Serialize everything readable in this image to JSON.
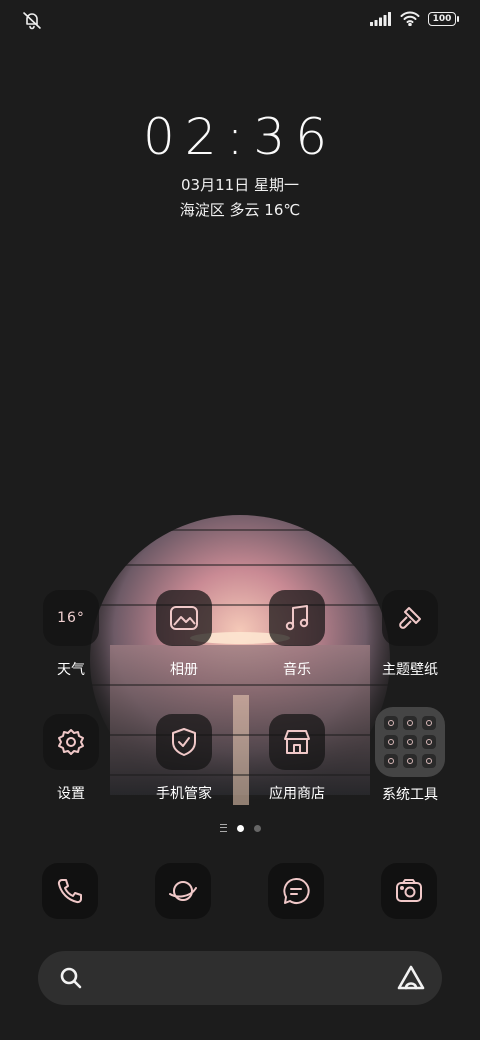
{
  "status_bar": {
    "mute_icon": "bell-off-icon",
    "signal_icon": "cellular-signal-icon",
    "wifi_icon": "wifi-icon",
    "battery_level": "100"
  },
  "clock": {
    "time": "02:36",
    "date": "03月11日 星期一",
    "weather": "海淀区 多云 16℃"
  },
  "apps_row1": [
    {
      "label": "天气",
      "tile_text": "16°",
      "icon": "weather-icon"
    },
    {
      "label": "相册",
      "icon": "gallery-icon"
    },
    {
      "label": "音乐",
      "icon": "music-note-icon"
    },
    {
      "label": "主题壁纸",
      "icon": "paintbrush-icon"
    }
  ],
  "apps_row2": [
    {
      "label": "设置",
      "icon": "gear-icon"
    },
    {
      "label": "手机管家",
      "icon": "shield-check-icon"
    },
    {
      "label": "应用商店",
      "icon": "store-icon"
    },
    {
      "label": "系统工具",
      "icon": "folder-icon"
    }
  ],
  "pager": {
    "pages": 2,
    "current": 1
  },
  "dock": [
    {
      "icon": "phone-icon"
    },
    {
      "icon": "browser-planet-icon"
    },
    {
      "icon": "messages-icon"
    },
    {
      "icon": "camera-icon"
    }
  ],
  "search": {
    "search_icon": "search-icon",
    "assistant_icon": "assistant-icon"
  },
  "colors": {
    "background": "#1c1c1c",
    "icon_line": "#f0c8c8",
    "sunset": "#e8a0a0"
  }
}
